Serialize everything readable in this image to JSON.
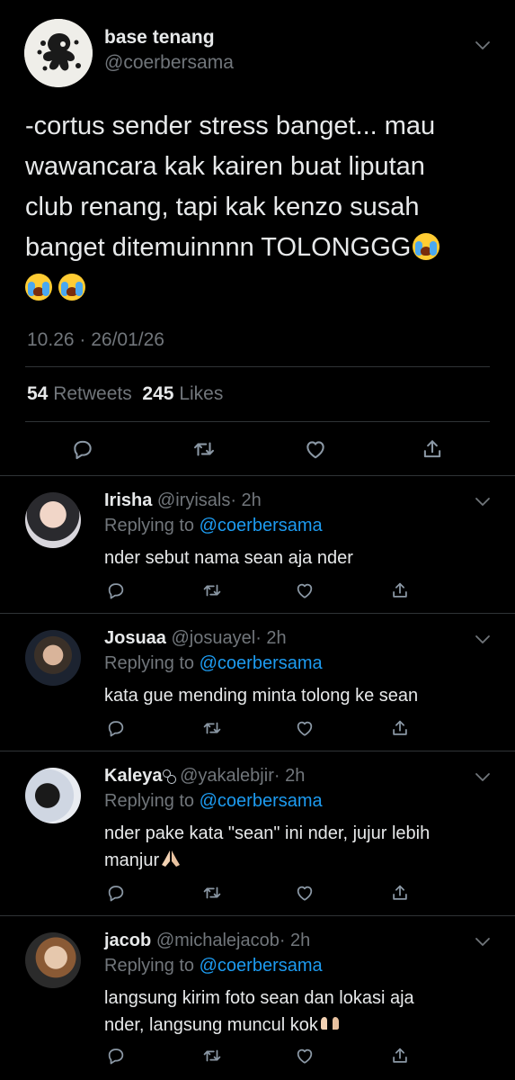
{
  "main_tweet": {
    "name": "base tenang",
    "handle": "@coerbersama",
    "text": "-cortus sender stress banget... mau wawancara kak kairen buat liputan club renang, tapi kak kenzo susah banget ditemuinnnn TOLONGGG",
    "emoji_names": [
      "loudly-crying-face",
      "loudly-crying-face",
      "loudly-crying-face"
    ],
    "timestamp": "10.26 · 26/01/26",
    "retweets_count": "54",
    "retweets_label": "Retweets",
    "likes_count": "245",
    "likes_label": "Likes"
  },
  "replies": [
    {
      "name": "Irisha",
      "handle": "@iryisals",
      "time": "· 2h",
      "replying_label": "Replying to",
      "replying_to": "@coerbersama",
      "text": "nder sebut nama sean aja nder"
    },
    {
      "name": "Josuaa",
      "handle": "@josuayel",
      "time": "· 2h",
      "replying_label": "Replying to",
      "replying_to": "@coerbersama",
      "text": "kata gue mending minta tolong ke sean"
    },
    {
      "name": "Kaleya",
      "handle": "@yakalebjir",
      "time": "· 2h",
      "replying_label": "Replying to",
      "replying_to": "@coerbersama",
      "text_line1": "nder pake kata \"sean\" ini nder, jujur lebih",
      "text_line2": "manjur"
    },
    {
      "name": "jacob",
      "handle": "@michalejacob",
      "time": "· 2h",
      "replying_label": "Replying to",
      "replying_to": "@coerbersama",
      "text_line1": "langsung kirim foto sean dan lokasi aja",
      "text_line2": "nder, langsung muncul kok"
    }
  ],
  "icons": {
    "reply": "speech-bubble-icon",
    "retweet": "retweet-arrows-icon",
    "like": "heart-icon",
    "share": "share-upload-icon",
    "more": "chevron-down-icon"
  },
  "colors": {
    "background": "#000000",
    "text": "#e7e9ea",
    "muted": "#71767b",
    "link": "#1d9bf0",
    "divider": "#2f3336"
  }
}
